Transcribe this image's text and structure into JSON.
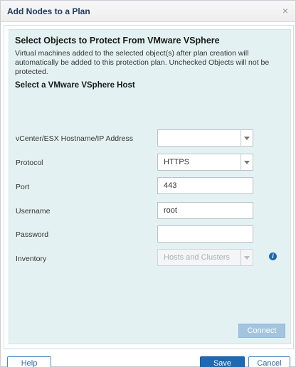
{
  "dialog": {
    "title": "Add Nodes to a Plan",
    "close_glyph": "×"
  },
  "panel": {
    "heading": "Select Objects to Protect From VMware VSphere",
    "description": "Virtual machines added to the selected object(s) after plan creation will automatically be added to this protection plan. Unchecked Objects will not be protected.",
    "subheading": "Select a VMware VSphere Host"
  },
  "form": {
    "hostname_label": "vCenter/ESX Hostname/IP Address",
    "hostname_value": "",
    "protocol_label": "Protocol",
    "protocol_value": "HTTPS",
    "port_label": "Port",
    "port_value": "443",
    "username_label": "Username",
    "username_value": "root",
    "password_label": "Password",
    "password_value": "",
    "inventory_label": "Inventory",
    "inventory_value": "Hosts and Clusters",
    "connect_label": "Connect"
  },
  "footer": {
    "help_label": "Help",
    "save_label": "Save",
    "cancel_label": "Cancel"
  },
  "icons": {
    "info": "info-icon",
    "close": "close-icon",
    "dropdown": "chevron-down-icon"
  },
  "colors": {
    "panel_bg": "#e4f1f3",
    "primary": "#1d69b3",
    "title": "#1f3a5f"
  }
}
